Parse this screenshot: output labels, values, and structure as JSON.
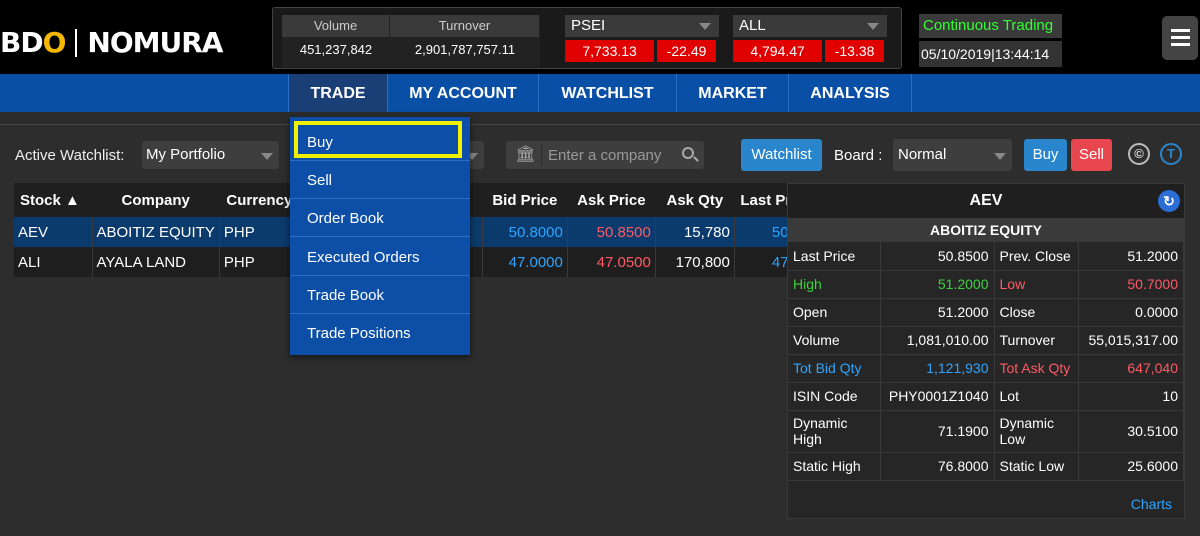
{
  "logo": {
    "left": "BD",
    "o": "O",
    "right": "NOMURA"
  },
  "ticker": {
    "volume_label": "Volume",
    "volume_value": "451,237,842",
    "turnover_label": "Turnover",
    "turnover_value": "2,901,787,757.11",
    "index1": {
      "name": "PSEI",
      "value": "7,733.13",
      "change": "-22.49"
    },
    "index2": {
      "name": "ALL",
      "value": "4,794.47",
      "change": "-13.38"
    }
  },
  "status": {
    "text": "Continuous Trading",
    "date": "05/10/2019",
    "time": "13:44:14"
  },
  "nav": {
    "items": [
      "TRADE",
      "MY ACCOUNT",
      "WATCHLIST",
      "MARKET",
      "ANALYSIS"
    ]
  },
  "dropdown": {
    "items": [
      "Buy",
      "Sell",
      "Order Book",
      "Executed Orders",
      "Trade Book",
      "Trade Positions"
    ]
  },
  "toolbar": {
    "active_watchlist_label": "Active Watchlist:",
    "watchlist_value": "My Portfolio",
    "search_placeholder": "Enter a company",
    "watchlist_button": "Watchlist",
    "board_label": "Board :",
    "board_value": "Normal",
    "buy_button": "Buy",
    "sell_button": "Sell"
  },
  "grid": {
    "headers": {
      "stock": "Stock ▲",
      "company": "Company",
      "currency": "Currency",
      "bid_price": "Bid Price",
      "ask_price": "Ask Price",
      "ask_qty": "Ask Qty",
      "last_price": "Last Pr"
    },
    "rows": [
      {
        "stock": "AEV",
        "company": "ABOITIZ EQUITY",
        "currency": "PHP",
        "bid_price": "50.8000",
        "ask_price": "50.8500",
        "ask_qty": "15,780",
        "last_price": "50."
      },
      {
        "stock": "ALI",
        "company": "AYALA LAND",
        "currency": "PHP",
        "bid_price": "47.0000",
        "ask_price": "47.0500",
        "ask_qty": "170,800",
        "last_price": "47."
      }
    ]
  },
  "detail": {
    "symbol": "AEV",
    "name": "ABOITIZ EQUITY",
    "rows": [
      {
        "l1": "Last Price",
        "v1": "50.8500",
        "l2": "Prev. Close",
        "v2": "51.2000"
      },
      {
        "l1": "High",
        "v1": "51.2000",
        "l2": "Low",
        "v2": "50.7000"
      },
      {
        "l1": "Open",
        "v1": "51.2000",
        "l2": "Close",
        "v2": "0.0000"
      },
      {
        "l1": "Volume",
        "v1": "1,081,010.00",
        "l2": "Turnover",
        "v2": "55,015,317.00"
      },
      {
        "l1": "Tot Bid Qty",
        "v1": "1,121,930",
        "l2": "Tot Ask Qty",
        "v2": "647,040"
      },
      {
        "l1": "ISIN Code",
        "v1": "PHY0001Z1040",
        "l2": "Lot",
        "v2": "10"
      },
      {
        "l1": "Dynamic High",
        "v1": "71.1900",
        "l2": "Dynamic Low",
        "v2": "30.5100"
      },
      {
        "l1": "Static High",
        "v1": "76.8000",
        "l2": "Static Low",
        "v2": "25.6000"
      }
    ],
    "charts_link": "Charts"
  },
  "colors": {
    "nav_blue": "#0a4fa6",
    "down_red": "#e00000",
    "highlight": "#f0f000",
    "status_green": "#33ff33"
  }
}
